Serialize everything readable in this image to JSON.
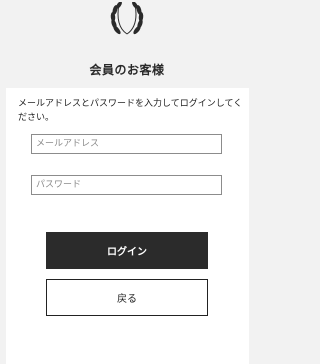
{
  "header": {
    "logo_icon": "laurel-wreath-icon",
    "title": "会員のお客様"
  },
  "form": {
    "instructions": "メールアドレスとパスワードを入力してログインしてください。",
    "email_placeholder": "メールアドレス",
    "password_placeholder": "パスワード",
    "login_label": "ログイン",
    "back_label": "戻る"
  },
  "colors": {
    "background": "#f2f2f2",
    "card": "#ffffff",
    "primary_button": "#2b2b2b",
    "text": "#222222"
  }
}
